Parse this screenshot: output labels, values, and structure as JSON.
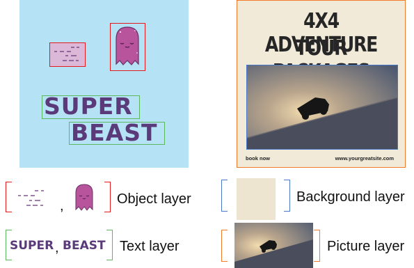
{
  "poster": {
    "title_line1": "4X4 ADVENTURE",
    "title_line2": "TOUR PACKAGES",
    "footer_left": "book now",
    "footer_right": "www.yourgreatsite.com"
  },
  "sticker_text": {
    "word1": "SUPER",
    "word2": "BEAST"
  },
  "legend": {
    "object_label": "Object layer",
    "background_label": "Background layer",
    "text_label": "Text layer",
    "picture_label": "Picture layer",
    "separator": ","
  },
  "colors": {
    "object_layer": "#e31a1c",
    "text_layer": "#5cb85c",
    "background_layer": "#4a78c9",
    "picture_layer": "#f07a2a",
    "sticker_purple": "#5b3a7a",
    "ghost_pink": "#b8549c",
    "sky_blue": "#b6e2f5"
  }
}
